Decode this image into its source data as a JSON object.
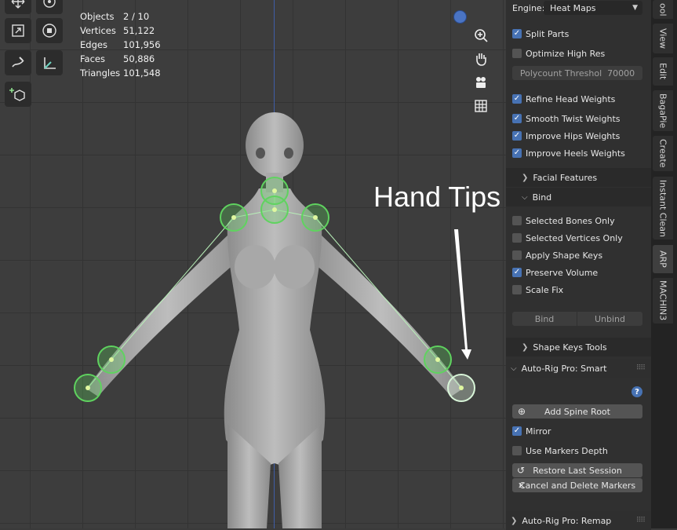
{
  "stats": [
    {
      "label": "Objects",
      "value": "2 / 10"
    },
    {
      "label": "Vertices",
      "value": "51,122"
    },
    {
      "label": "Edges",
      "value": "101,956"
    },
    {
      "label": "Faces",
      "value": "50,886"
    },
    {
      "label": "Triangles",
      "value": "101,548"
    }
  ],
  "annotation": "Hand Tips",
  "toolbar_icons": [
    "move-icon",
    "rotate-icon",
    "scale-icon",
    "transform-icon",
    "annotate-icon",
    "measure-icon",
    "add-cube-icon"
  ],
  "nav_icons": [
    "zoom-icon",
    "pan-hand-icon",
    "camera-icon",
    "grid-icon"
  ],
  "panel": {
    "engine_label": "Engine:",
    "engine_value": "Heat Maps",
    "split_parts": "Split Parts",
    "optimize_high_res": "Optimize High Res",
    "polycount_label": "Polycount Threshol",
    "polycount_value": "70000",
    "refine_head": "Refine Head Weights",
    "smooth_twist": "Smooth Twist Weights",
    "improve_hips": "Improve Hips Weights",
    "improve_heels": "Improve Heels Weights",
    "facial_features": "Facial Features",
    "bind_section": "Bind",
    "selected_bones_only": "Selected Bones Only",
    "selected_vertices_only": "Selected Vertices Only",
    "apply_shape_keys": "Apply Shape Keys",
    "preserve_volume": "Preserve Volume",
    "scale_fix": "Scale Fix",
    "bind_button": "Bind",
    "unbind_button": "Unbind",
    "shape_keys_tools": "Shape Keys Tools",
    "smart_header": "Auto-Rig Pro: Smart",
    "help": "?",
    "add_spine_root": "Add Spine Root",
    "mirror": "Mirror",
    "use_markers_depth": "Use Markers Depth",
    "restore_last_session": "Restore Last Session",
    "cancel_delete_markers": "Cancel and Delete Markers",
    "remap_header": "Auto-Rig Pro: Remap"
  },
  "tabs": [
    "ool",
    "View",
    "Edit",
    "BagaPie",
    "Create",
    "Instant Clean",
    "ARP",
    "MACHIN3"
  ],
  "active_tab": "ARP",
  "colors": {
    "accent": "#4772b3",
    "marker": "#5fd35f",
    "axis": "#3f5ea8"
  }
}
